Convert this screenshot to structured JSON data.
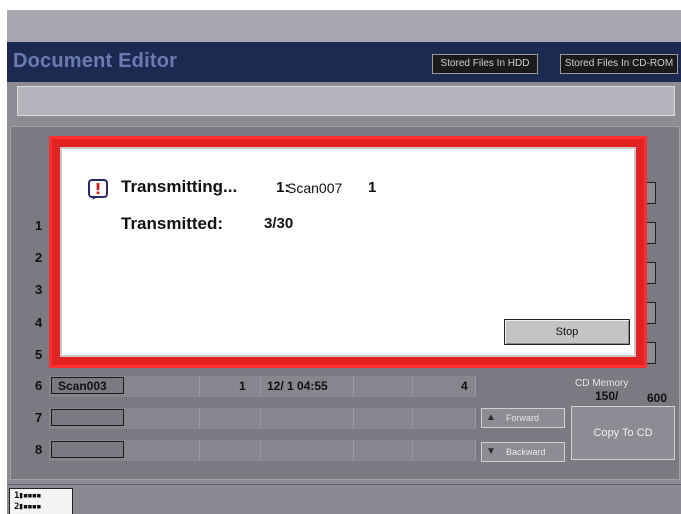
{
  "header": {
    "title": "Document Editor",
    "stored_hdd": "Stored Files In HDD",
    "stored_cdrom": "Stored Files In CD-ROM"
  },
  "rows": [
    {
      "num": "1"
    },
    {
      "num": "2"
    },
    {
      "num": "3"
    },
    {
      "num": "4"
    },
    {
      "num": "5"
    },
    {
      "num": "6",
      "name": "Scan003",
      "copies": "1",
      "date": "12/ 1 04:55",
      "pages": "4"
    },
    {
      "num": "7",
      "name": ""
    },
    {
      "num": "8",
      "name": ""
    }
  ],
  "nav": {
    "forward": "Forward",
    "backward": "Backward",
    "forward_icon": "triangle-up-icon",
    "backward_icon": "triangle-down-icon"
  },
  "cd": {
    "memory_label": "CD Memory",
    "used": "150/",
    "total": "600",
    "copy_button": "Copy To CD"
  },
  "dialog": {
    "status": "Transmitting...",
    "job_num": "1:",
    "job_file": "Scan007",
    "job_count": "1",
    "transmitted_label": "Transmitted:",
    "transmitted_value": "3/30",
    "stop_button": "Stop",
    "icon": "alert-icon",
    "border_color": "#e22222"
  },
  "status_mini": {
    "line1": "1",
    "line2": "2"
  }
}
